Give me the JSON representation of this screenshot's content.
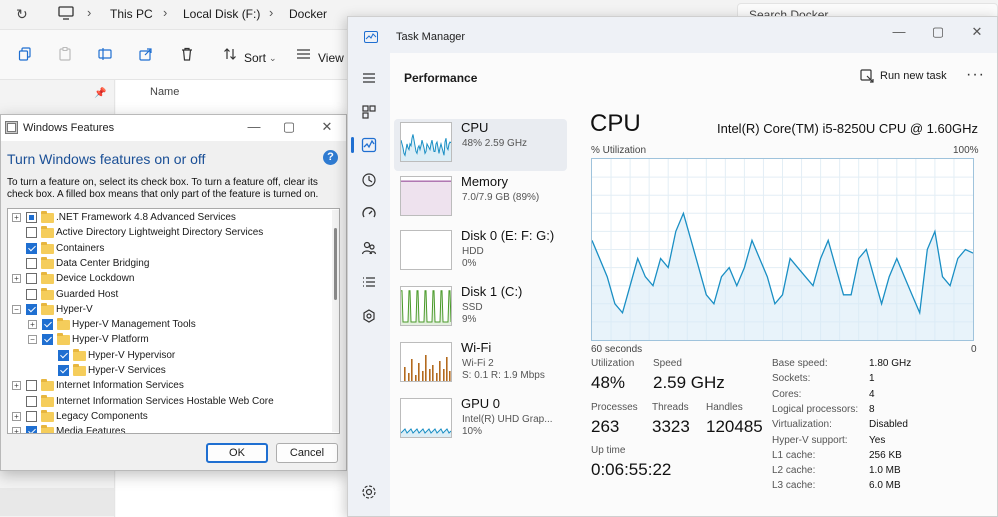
{
  "explorer": {
    "breadcrumb": [
      "This PC",
      "Local Disk (F:)",
      "Docker"
    ],
    "search_placeholder": "Search Docker",
    "toolbar": {
      "sort_label": "Sort",
      "view_label": "View"
    },
    "list_header": "Name"
  },
  "windows_features": {
    "title": "Windows Features",
    "heading": "Turn Windows features on or off",
    "help_glyph": "?",
    "description": "To turn a feature on, select its check box. To turn a feature off, clear its check box. A filled box means that only part of the feature is turned on.",
    "items": [
      {
        "label": ".NET Framework 4.8 Advanced Services",
        "state": "partial",
        "expander": "+",
        "level": 0
      },
      {
        "label": "Active Directory Lightweight Directory Services",
        "state": "off",
        "expander": "",
        "level": 0
      },
      {
        "label": "Containers",
        "state": "on",
        "expander": "",
        "level": 0
      },
      {
        "label": "Data Center Bridging",
        "state": "off",
        "expander": "",
        "level": 0
      },
      {
        "label": "Device Lockdown",
        "state": "off",
        "expander": "+",
        "level": 0
      },
      {
        "label": "Guarded Host",
        "state": "off",
        "expander": "",
        "level": 0
      },
      {
        "label": "Hyper-V",
        "state": "on",
        "expander": "−",
        "level": 0
      },
      {
        "label": "Hyper-V Management Tools",
        "state": "on",
        "expander": "+",
        "level": 1
      },
      {
        "label": "Hyper-V Platform",
        "state": "on",
        "expander": "−",
        "level": 1
      },
      {
        "label": "Hyper-V Hypervisor",
        "state": "on",
        "expander": "",
        "level": 2
      },
      {
        "label": "Hyper-V Services",
        "state": "on",
        "expander": "",
        "level": 2
      },
      {
        "label": "Internet Information Services",
        "state": "off",
        "expander": "+",
        "level": 0
      },
      {
        "label": "Internet Information Services Hostable Web Core",
        "state": "off",
        "expander": "",
        "level": 0
      },
      {
        "label": "Legacy Components",
        "state": "off",
        "expander": "+",
        "level": 0
      },
      {
        "label": "Media Features",
        "state": "on",
        "expander": "+",
        "level": 0
      }
    ],
    "ok_label": "OK",
    "cancel_label": "Cancel"
  },
  "task_manager": {
    "title": "Task Manager",
    "page_heading": "Performance",
    "run_new_task": "Run new task",
    "more": "···",
    "devices": [
      {
        "name": "CPU",
        "sub1": "48% 2.59 GHz",
        "sub2": "",
        "color": "#1a8fc4",
        "selected": true
      },
      {
        "name": "Memory",
        "sub1": "7.0/7.9 GB (89%)",
        "sub2": "",
        "color": "#8b3a8f",
        "selected": false
      },
      {
        "name": "Disk 0 (E: F: G:)",
        "sub1": "HDD",
        "sub2": "0%",
        "color": "#4a9a2a",
        "selected": false
      },
      {
        "name": "Disk 1 (C:)",
        "sub1": "SSD",
        "sub2": "9%",
        "color": "#4a9a2a",
        "selected": false
      },
      {
        "name": "Wi-Fi",
        "sub1": "Wi-Fi 2",
        "sub2": "S: 0.1  R: 1.9 Mbps",
        "color": "#b36a1e",
        "selected": false
      },
      {
        "name": "GPU 0",
        "sub1": "Intel(R) UHD Grap...",
        "sub2": "10%",
        "color": "#1a8fc4",
        "selected": false
      }
    ],
    "cpu": {
      "title": "CPU",
      "model": "Intel(R) Core(TM) i5-8250U CPU @ 1.60GHz",
      "graph_label": "% Utilization",
      "graph_max": "100%",
      "graph_span": "60 seconds",
      "graph_min": "0",
      "utilization_label": "Utilization",
      "utilization": "48%",
      "speed_label": "Speed",
      "speed": "2.59 GHz",
      "processes_label": "Processes",
      "processes": "263",
      "threads_label": "Threads",
      "threads": "3323",
      "handles_label": "Handles",
      "handles": "120485",
      "uptime_label": "Up time",
      "uptime": "0:06:55:22",
      "info": [
        {
          "k": "Base speed:",
          "v": "1.80 GHz"
        },
        {
          "k": "Sockets:",
          "v": "1"
        },
        {
          "k": "Cores:",
          "v": "4"
        },
        {
          "k": "Logical processors:",
          "v": "8"
        },
        {
          "k": "Virtualization:",
          "v": "Disabled"
        },
        {
          "k": "Hyper-V support:",
          "v": "Yes"
        },
        {
          "k": "L1 cache:",
          "v": "256 KB"
        },
        {
          "k": "L2 cache:",
          "v": "1.0 MB"
        },
        {
          "k": "L3 cache:",
          "v": "6.0 MB"
        }
      ],
      "history": [
        55,
        45,
        35,
        20,
        15,
        30,
        45,
        35,
        30,
        45,
        40,
        60,
        70,
        55,
        40,
        25,
        20,
        35,
        40,
        30,
        40,
        55,
        45,
        35,
        20,
        25,
        45,
        40,
        35,
        30,
        45,
        55,
        40,
        25,
        25,
        45,
        50,
        35,
        20,
        35,
        45,
        35,
        25,
        15,
        50,
        60,
        35,
        30,
        45,
        50,
        48
      ]
    }
  }
}
